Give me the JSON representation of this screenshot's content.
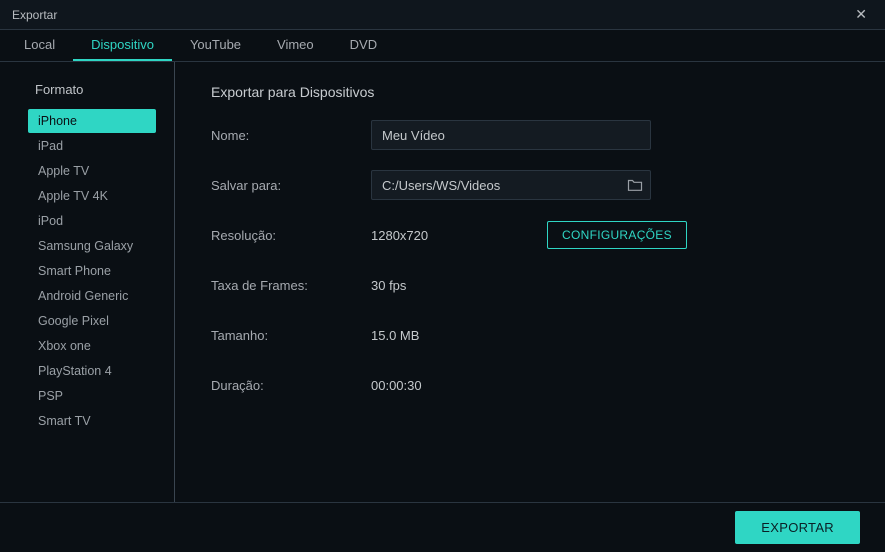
{
  "window": {
    "title": "Exportar"
  },
  "tabs": [
    {
      "label": "Local"
    },
    {
      "label": "Dispositivo"
    },
    {
      "label": "YouTube"
    },
    {
      "label": "Vimeo"
    },
    {
      "label": "DVD"
    }
  ],
  "sidebar": {
    "heading": "Formato",
    "items": [
      "iPhone",
      "iPad",
      "Apple TV",
      "Apple TV 4K",
      "iPod",
      "Samsung Galaxy",
      "Smart Phone",
      "Android Generic",
      "Google Pixel",
      "Xbox one",
      "PlayStation 4",
      "PSP",
      "Smart TV"
    ]
  },
  "main": {
    "section_title": "Exportar para Dispositivos",
    "name_label": "Nome:",
    "name_value": "Meu Vídeo",
    "save_to_label": "Salvar para:",
    "save_to_value": "C:/Users/WS/Videos",
    "resolution_label": "Resolução:",
    "resolution_value": "1280x720",
    "settings_button": "CONFIGURAÇÕES",
    "framerate_label": "Taxa de Frames:",
    "framerate_value": "30 fps",
    "size_label": "Tamanho:",
    "size_value": "15.0 MB",
    "duration_label": "Duração:",
    "duration_value": "00:00:30"
  },
  "footer": {
    "export_button": "EXPORTAR"
  }
}
